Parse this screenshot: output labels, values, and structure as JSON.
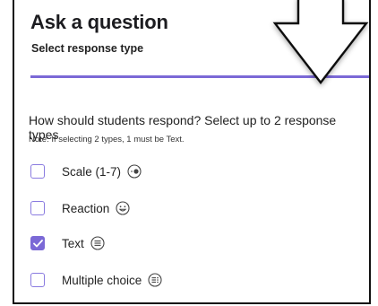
{
  "header": {
    "title": "Ask a question",
    "subtitle": "Select response type"
  },
  "question": {
    "prompt": "How should students respond? Select up to 2 response types",
    "note": "Note: If selecting 2 types, 1 must be Text."
  },
  "options": [
    {
      "label": "Scale (1-7)",
      "checked": false,
      "icon": "scale-icon"
    },
    {
      "label": "Reaction",
      "checked": false,
      "icon": "smiley-icon"
    },
    {
      "label": "Text",
      "checked": true,
      "icon": "text-lines-icon"
    },
    {
      "label": "Multiple choice",
      "checked": false,
      "icon": "list-icon"
    }
  ],
  "colors": {
    "accent": "#7b69d6",
    "text": "#222222"
  }
}
